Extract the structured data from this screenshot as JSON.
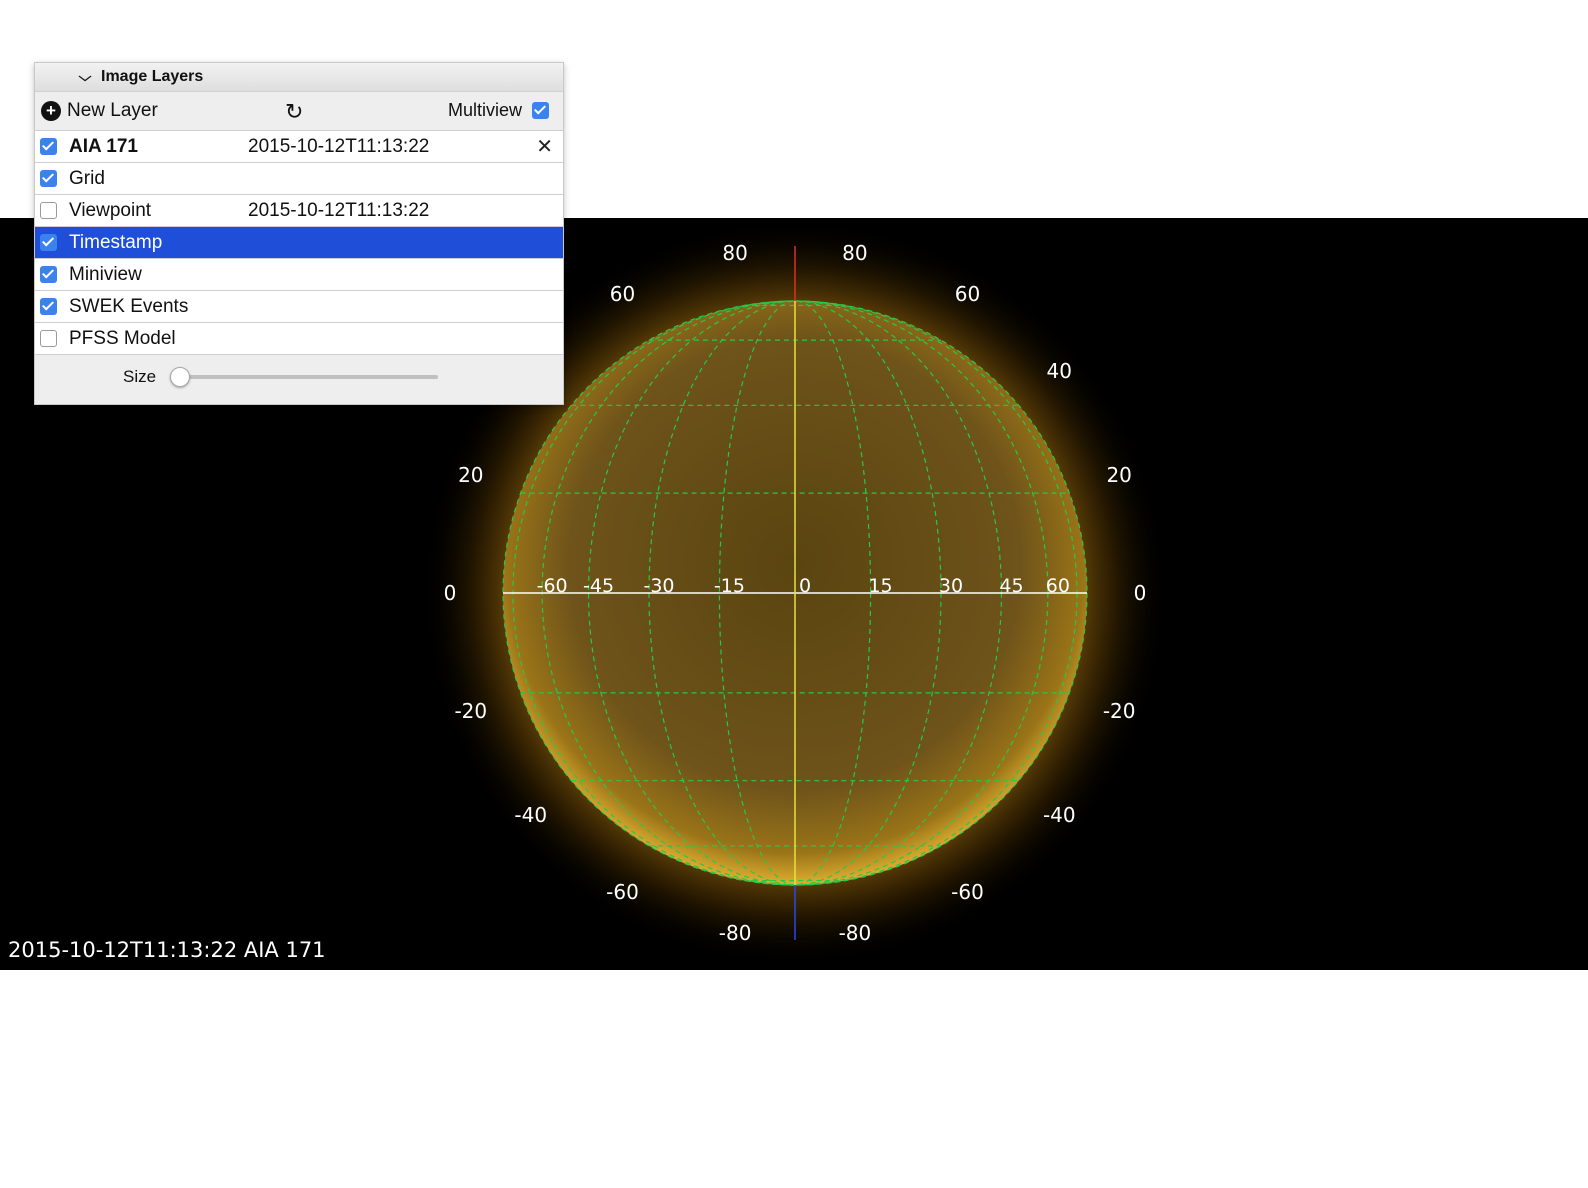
{
  "panel": {
    "title": "Image Layers",
    "new_layer_label": "New Layer",
    "multiview_label": "Multiview",
    "multiview_checked": true,
    "size_label": "Size",
    "size_value": 0
  },
  "layers": [
    {
      "name": "AIA 171",
      "time": "2015-10-12T11:13:22",
      "checked": true,
      "bold": true,
      "closable": true,
      "selected": false
    },
    {
      "name": "Grid",
      "time": "",
      "checked": true,
      "bold": false,
      "closable": false,
      "selected": false
    },
    {
      "name": "Viewpoint",
      "time": "2015-10-12T11:13:22",
      "checked": false,
      "bold": false,
      "closable": false,
      "selected": false
    },
    {
      "name": "Timestamp",
      "time": "",
      "checked": true,
      "bold": false,
      "closable": false,
      "selected": true
    },
    {
      "name": "Miniview",
      "time": "",
      "checked": true,
      "bold": false,
      "closable": false,
      "selected": false
    },
    {
      "name": "SWEK Events",
      "time": "",
      "checked": true,
      "bold": false,
      "closable": false,
      "selected": false
    },
    {
      "name": "PFSS Model",
      "time": "",
      "checked": false,
      "bold": false,
      "closable": false,
      "selected": false
    }
  ],
  "viewport": {
    "timestamp": "2015-10-12T11:13:22 AIA 171",
    "lat_labels_left": [
      "80",
      "60",
      "20",
      "0",
      "-20",
      "-40",
      "-60",
      "-80"
    ],
    "lat_labels_right": [
      "80",
      "60",
      "40",
      "20",
      "0",
      "-20",
      "-40",
      "-60",
      "-80"
    ],
    "lon_labels": [
      "-60",
      "-45",
      "-30",
      "-15",
      "0",
      "15",
      "30",
      "45",
      "60"
    ],
    "colors": {
      "sun": "#b58a1c",
      "grid": "#27c84a",
      "axis": "#e8e23a",
      "north": "#e0301e",
      "south": "#2a48e6"
    }
  },
  "icons": {
    "add": "plus-circle-icon",
    "sync": "sync-icon",
    "close": "close-icon",
    "collapse": "chevron-down-icon"
  }
}
